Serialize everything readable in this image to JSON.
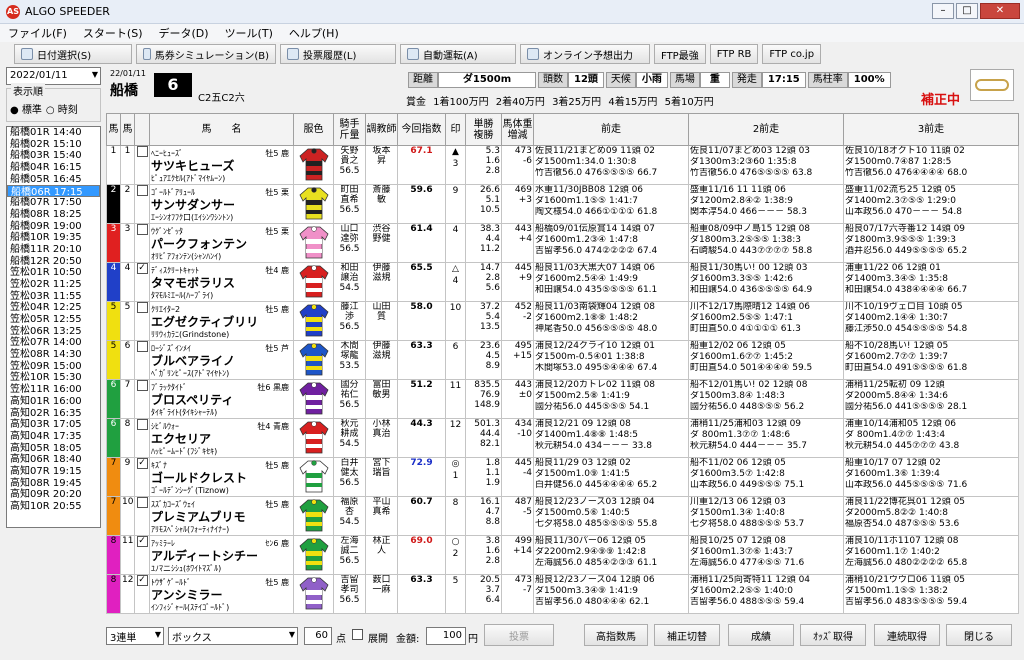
{
  "app": {
    "title": "ALGO SPEEDER",
    "icon_text": "AS"
  },
  "menu": [
    "ファイル(F)",
    "スタート(S)",
    "データ(D)",
    "ツール(T)",
    "ヘルプ(H)"
  ],
  "toolbar": [
    "日付選択(S)",
    "馬券シミュレーション(B)",
    "投票履歴(L)",
    "自動運転(A)",
    "オンライン予想出力",
    "FTP最強",
    "FTP RB",
    "FTP co.jp"
  ],
  "left": {
    "date": "2022/01/11",
    "order_label": "表示順",
    "radio1": "● 標準",
    "radio2": "○ 時刻",
    "races": [
      "船橋01R 14:40",
      "船橋02R 15:10",
      "船橋03R 15:40",
      "船橋04R 16:15",
      "船橋05R 16:45",
      "船橋06R 17:15",
      "船橋07R 17:50",
      "船橋08R 18:25",
      "船橋09R 19:00",
      "船橋10R 19:35",
      "船橋11R 20:10",
      "船橋12R 20:50",
      "笠松01R 10:50",
      "笠松02R 11:25",
      "笠松03R 11:55",
      "笠松04R 12:25",
      "笠松05R 12:55",
      "笠松06R 13:25",
      "笠松07R 14:00",
      "笠松08R 14:30",
      "笠松09R 15:00",
      "笠松10R 15:30",
      "笠松11R 16:00",
      "高知01R 16:00",
      "高知02R 16:35",
      "高知03R 17:05",
      "高知04R 17:35",
      "高知05R 18:05",
      "高知06R 18:40",
      "高知07R 19:15",
      "高知08R 19:45",
      "高知09R 20:20",
      "高知10R 20:55"
    ]
  },
  "race": {
    "date": "22/01/11",
    "venue": "船橋",
    "number": "6",
    "class": "C2五C2六",
    "dist_label": "距離",
    "dist": "ダ1500m",
    "heads_label": "頭数",
    "heads": "12頭",
    "weather_label": "天候",
    "weather": "小雨",
    "track_label": "馬場",
    "track": "重",
    "start_label": "発走",
    "start": "17:15",
    "post_label": "馬柱率",
    "post": "100%",
    "prize": "賞金 1着100万円 2着40万円 3着25万円 4着15万円 5着10万円",
    "correction": "補正中"
  },
  "columns": [
    "馬",
    "馬",
    "馬　　名",
    "服色",
    "騎手\n斤量",
    "調教師",
    "今回指数",
    "印",
    "単勝\n複勝",
    "馬体重\n増減",
    "前走",
    "2前走",
    "3前走"
  ],
  "horses": [
    {
      "waku": "1",
      "wcolor": "#ffffff",
      "no": "1",
      "chk": "",
      "sire": "ﾍﾆｰﾋｭｰｽﾞ",
      "sex": "牡5 鹿",
      "name": "サツキヒューズ",
      "dam": "ﾋﾟｭｱｴｸｾﾙ(ｱﾄﾞﾏｲﾔﾑｰﾝ)",
      "jockey": "矢野\n貴之\n56.5",
      "trainer": "坂本\n昇",
      "idx": "67.1",
      "idxc": "#d01818",
      "mark": "▲\n3",
      "odds": "5.3\n1.6\n2.8",
      "wt": "473\n-6",
      "c1": "#cc2222",
      "c2": "#222222",
      "p": [
        [
          "佐良11/21まどめ09 11頭 02",
          "ダ1500m1:34.0 1:30:8",
          "竹吉徹56.0 476⑤⑤⑤⑤ 66.7"
        ],
        [
          "佐良11/07まどめ03 12頭 03",
          "ダ1300m3:2③60 1:35:8",
          "竹吉徹56.0 476⑤⑤⑤⑤ 63.8"
        ],
        [
          "佐良10/18オクト10 11頭 02",
          "ダ1500m0.7④87 1:28:5",
          "竹吉徹56.0 476④④④④ 68.0"
        ]
      ]
    },
    {
      "waku": "2",
      "wcolor": "#000000",
      "no": "2",
      "chk": "",
      "sire": "ｺﾞｰﾙﾄﾞｱﾘｭｰﾙ",
      "sex": "牡5 栗",
      "name": "サンサダンサー",
      "dam": "ｴｰｼﾝｵﾌﾌｸ口(ｴｲｼﾝﾜｼﾝﾄﾝ)",
      "jockey": "町田\n直希\n56.5",
      "trainer": "斎藤\n敏",
      "idx": "59.6",
      "idxc": "#000",
      "mark": "9",
      "odds": "26.6\n5.1\n10.5",
      "wt": "469\n+3",
      "c1": "#e8e020",
      "c2": "#222222",
      "p": [
        [
          "水重11/30JBB08 12頭 06",
          "ダ1600m1.1⑤⑤ 1:41:7",
          "陶文様54.0 466①①①① 61.8"
        ],
        [
          "盛重11/16 11 11頭 06",
          "ダ1200m2.8④② 1:38:9",
          "関本淳54.0 466－－－ 58.3"
        ],
        [
          "盛重11/02流ち25 12頭 05",
          "ダ1400m2.3⑦⑤⑤ 1:29:0",
          "山本政56.0 470－－－ 54.8"
        ]
      ]
    },
    {
      "waku": "3",
      "wcolor": "#e02020",
      "no": "3",
      "chk": "",
      "sire": "ｳｸﾞﾝｾﾞｯﾀ",
      "sex": "牡5 栗",
      "name": "パークフォンテン",
      "dam": "ｵﾘﾋﾞｱﾌｫﾝﾃﾝ(ｼｬﾝﾊﾝｲ)",
      "jockey": "山口\n達弥\n56.5",
      "trainer": "渋谷\n野健",
      "idx": "61.4",
      "idxc": "#000",
      "mark": "4",
      "odds": "38.3\n4.4\n11.2",
      "wt": "443\n+4",
      "c1": "#f090c8",
      "c2": "#ffffff",
      "p": [
        [
          "船橋09/01伝原賞14 14頭 07",
          "ダ1600m1.2③④ 1:47:8",
          "吉留孝56.0 474②②②② 67.4"
        ],
        [
          "船重08/09中ノ島15 12頭 08",
          "ダ1800m3.2⑤⑤⑤ 1:38:3",
          "石崎駿54.0 443⑦⑦⑦⑦ 58.8"
        ],
        [
          "船良07/17六寺番12 14頭 09",
          "ダ1800m3.9⑤⑤⑤ 1:39:3",
          "酒井忍56.0 449⑤⑤⑤⑤ 65.2"
        ]
      ]
    },
    {
      "waku": "4",
      "wcolor": "#2040c8",
      "no": "4",
      "chk": "✓",
      "sire": "ﾃﾞｨｽｸﾘｰﾄｷｬｯﾄ",
      "sex": "牡4 鹿",
      "name": "タマモボラリス",
      "dam": "ﾀﾏﾓﾙﾐｴｰﾙ(ﾊｰﾌﾞﾗｲ)",
      "jockey": "和田\n譲治\n54.5",
      "trainer": "伊藤\n滋規",
      "idx": "65.5",
      "idxc": "#000",
      "mark": "△\n4",
      "odds": "14.7\n2.8\n5.6",
      "wt": "445\n+9",
      "c1": "#d82020",
      "c2": "#ffffff",
      "p": [
        [
          "船良11/03大黒大07 14頭 06",
          "ダ1600m2.5④④ 1:49:9",
          "和田譲54.0 435⑤⑤⑤⑤ 61.1"
        ],
        [
          "船良11/30馬い! 00 12頭 03",
          "ダ1600m3.3⑤⑤ 1:42:6",
          "和田譲54.0 436⑤⑤⑤⑤ 64.9"
        ],
        [
          "浦重11/22 06 12頭 01",
          "ダ1400m3.3④⑤ 1:35:8",
          "和田譲54.0 438④④④④ 66.7"
        ]
      ]
    },
    {
      "waku": "5",
      "wcolor": "#f0e010",
      "no": "5",
      "chk": "",
      "sire": "ｸﾘｴｲﾀｰ2",
      "sex": "牡5 鹿",
      "name": "エグゼクティブリリ",
      "dam": "ﾘﾘｳｨｶﾗﾆ(Grindstone)",
      "jockey": "藤江\n渉\n56.5",
      "trainer": "山田\n質",
      "idx": "58.0",
      "idxc": "#000",
      "mark": "10",
      "odds": "37.2\n5.4\n13.5",
      "wt": "452\n-2",
      "c1": "#2040c8",
      "c2": "#f0e010",
      "p": [
        [
          "船良11/03南袋輝04 12頭 08",
          "ダ1600m2.1⑧⑧ 1:48:2",
          "神尾香50.0 456⑤⑤⑤⑤ 48.0"
        ],
        [
          "川不12/17馬際晴12 14頭 06",
          "ダ1600m2.5⑤⑤ 1:47:1",
          "町田直50.0 4①①①① 61.3"
        ],
        [
          "川不10/19ヴェロ目 10頭 05",
          "ダ1400m2.1④④ 1:30:7",
          "藤江渉50.0 454⑤⑤⑤⑤ 54.8"
        ]
      ]
    },
    {
      "waku": "5",
      "wcolor": "#f0e010",
      "no": "6",
      "chk": "",
      "sire": "ﾛｰｼﾞｽﾞｲﾝﾒｲ",
      "sex": "牡5 芦",
      "name": "ブルベアライノ",
      "dam": "ﾍﾞｶﾞﾘﾝﾋﾟｰｽ(ｱﾄﾞﾏｲﾔﾄﾝ)",
      "jockey": "木間\n塚龍\n53.5",
      "trainer": "伊藤\n滋規",
      "idx": "63.3",
      "idxc": "#000",
      "mark": "6",
      "odds": "23.6\n4.5\n8.9",
      "wt": "495\n+15",
      "c1": "#1e56c8",
      "c2": "#f0e010",
      "p": [
        [
          "浦良12/24クライ10 12頭 01",
          "ダ1500m-0.5④01 1:38:8",
          "木間塚53.0 495⑤④④④ 67.4"
        ],
        [
          "船重12/02 06 12頭 05",
          "ダ1600m1.6⑦⑦ 1:45:2",
          "町田直54.0 501④④④④ 59.5"
        ],
        [
          "船不10/28馬い! 12頭 05",
          "ダ1600m2.7⑦⑦ 1:39:7",
          "町田直54.0 491⑤⑤⑤⑤ 61.8"
        ]
      ]
    },
    {
      "waku": "6",
      "wcolor": "#20a040",
      "no": "7",
      "chk": "",
      "sire": "ﾌﾞﾗｯｸﾀｲﾄﾞ",
      "sex": "牡6 黒鹿",
      "name": "ブロスペリティ",
      "dam": "ﾀｲｷﾞﾗｲﾄ(ﾀｲｷｼｬｰﾃﾙ)",
      "jockey": "國分\n祐仁\n56.5",
      "trainer": "富田\n敏男",
      "idx": "51.2",
      "idxc": "#000",
      "mark": "11",
      "odds": "835.5\n76.9\n148.9",
      "wt": "443\n±0",
      "c1": "#7020a0",
      "c2": "#ffffff",
      "p": [
        [
          "浦良12/20カトレ02 11頭 08",
          "ダ1500m2.5⑧ 1:41:9",
          "國分祐56.0 445⑤⑤⑤ 54.1"
        ],
        [
          "船不12/01馬い! 02 12頭 08",
          "ダ1500m3.8④ 1:48:3",
          "國分祐56.0 448⑤⑤⑤ 56.2"
        ],
        [
          "浦稍11/25転初 09 12頭 ",
          "ダ2000m5.8④④ 1:34:6",
          "國分祐56.0 441⑤⑤⑤⑤ 28.1"
        ]
      ]
    },
    {
      "waku": "6",
      "wcolor": "#20a040",
      "no": "8",
      "chk": "",
      "sire": "ｼﾋﾞﾙｳｫｰ",
      "sex": "牡4 青鹿",
      "name": "エクセリア",
      "dam": "ﾊｯﾋﾟｰﾑｰﾄﾞ(ﾌｼﾞｷｾｷ)",
      "jockey": "秋元\n耕成\n54.5",
      "trainer": "小林\n真治",
      "idx": "44.3",
      "idxc": "#000",
      "mark": "12",
      "odds": "501.3\n44.4\n82.1",
      "wt": "434\n-10",
      "c1": "#d82020",
      "c2": "#ffffff",
      "p": [
        [
          "浦良12/21 09 12頭 08",
          "ダ1400m1.4⑧⑧ 1:48:5",
          "秋元耕54.0 434－－－ 33.8"
        ],
        [
          "浦稍11/25浦和03 12頭 09",
          "ダ 800m1.3⑦⑦ 1:48:6",
          "秋元耕54.0 444－－－ 35.7"
        ],
        [
          "浦重10/14浦和05 12頭 06",
          "ダ 800m1.4⑦⑦ 1:43:4",
          "秋元耕54.0 445⑦⑦⑦ 43.8"
        ]
      ]
    },
    {
      "waku": "7",
      "wcolor": "#f08c10",
      "no": "9",
      "chk": "✓",
      "sire": "ｷｽﾞﾅ",
      "sex": "牡5 鹿",
      "name": "ゴールドクレスト",
      "dam": "ｺﾞｰﾙﾃﾞﾝｼｰｸﾞ(Tiznow)",
      "jockey": "白井\n健太\n56.5",
      "trainer": "宮下\n瑞旨",
      "idx": "72.9",
      "idxc": "#1a2ec8",
      "mark": "◎\n1",
      "odds": "1.8\n1.1\n1.9",
      "wt": "445\n-4",
      "c1": "#ffffff",
      "c2": "#20a040",
      "p": [
        [
          "船良11/29 03 12頭 02",
          "ダ1500m1.0⑨ 1:41:5",
          "白井健56.0 445④④④④ 65.2"
        ],
        [
          "船不11/02 06 12頭 05",
          "ダ1600m3.5⑦ 1:42:8",
          "山本政56.0 449⑤⑤⑤ 75.1"
        ],
        [
          "船重10/17 07 12頭 02",
          "ダ1600m1.3⑥ 1:39:4",
          "山本政56.0 445⑤⑤⑤⑤ 71.6"
        ]
      ]
    },
    {
      "waku": "7",
      "wcolor": "#f08c10",
      "no": "10",
      "chk": "",
      "sire": "ｽｽﾞｶｺｰｽﾞｳｪｲ",
      "sex": "牡5 鹿",
      "name": "プレミアムブリモ",
      "dam": "ｱﾘﾓｽﾍﾟｼｬﾙ(ﾌｫｰﾃｨﾅｲﾅｰ)",
      "jockey": "福原\n杏\n54.5",
      "trainer": "平山\n真希",
      "idx": "60.7",
      "idxc": "#000",
      "mark": "8",
      "odds": "16.1\n4.7\n8.8",
      "wt": "487\n-5",
      "c1": "#20a040",
      "c2": "#f0e010",
      "p": [
        [
          "船良12/23ノース03 12頭 04",
          "ダ1500m0.5⑥ 1:40:5",
          "七夕将58.0 485⑤⑤⑤⑤ 55.8"
        ],
        [
          "川重12/13 06 12頭 03",
          "ダ1500m1.3④ 1:40:8",
          "七夕将58.0 488⑤⑤⑤ 53.7"
        ],
        [
          "浦良11/22博花呉01 12頭 05",
          "ダ2000m5.8②② 1:40:8",
          "福原杏54.0 487⑤⑤⑤ 53.6"
        ]
      ]
    },
    {
      "waku": "8",
      "wcolor": "#e020c0",
      "no": "11",
      "chk": "✓",
      "sire": "ｱｯﾐﾗｰﾚ",
      "sex": "ｾﾝ6 鹿",
      "name": "アルディートシチー",
      "dam": "ﾕﾉﾏニｼｼｭ(ﾎﾜｲﾄﾏｽﾞﾙ)",
      "jockey": "左海\n誠二\n56.5",
      "trainer": "林正\n人",
      "idx": "69.0",
      "idxc": "#d01818",
      "mark": "○\n2",
      "odds": "3.8\n1.6\n2.8",
      "wt": "499\n+14",
      "c1": "#20a040",
      "c2": "#f0e010",
      "p": [
        [
          "船良11/30パー06 12頭 05",
          "ダ2200m2.9④⑨⑨ 1:42:8",
          "左海誠56.0 485④②③③ 61.1"
        ],
        [
          "船良10/25 07 12頭 08",
          "ダ1600m1.3⑦⑥ 1:43:7",
          "左海誠56.0 477④⑤⑤ 71.6"
        ],
        [
          "浦良10/11ホ1107 12頭 08",
          "ダ1600m1.1⑦ 1:40:2",
          "左海誠56.0 480②②②② 65.8"
        ]
      ]
    },
    {
      "waku": "8",
      "wcolor": "#e020c0",
      "no": "12",
      "chk": "✓",
      "sire": "ﾄｳｻﾞｹﾞｰﾙﾄﾞ",
      "sex": "牡5 鹿",
      "name": "アンシミラー",
      "dam": "ｲﾝﾌｨｼﾞｬｰﾙ(ｽﾃｲｺﾞｰﾙﾄﾞ)",
      "jockey": "吉留\n孝司\n56.5",
      "trainer": "薮口\n一麻",
      "idx": "63.3",
      "idxc": "#000",
      "mark": "5",
      "odds": "20.5\n3.7\n6.4",
      "wt": "473\n-7",
      "c1": "#9060c8",
      "c2": "#ffffff",
      "p": [
        [
          "船良12/23ノース04 12頭 06",
          "ダ1500m3.3④⑨ 1:41:9",
          "吉留孝56.0 480④④④ 62.1"
        ],
        [
          "浦稍11/25向寄特11 12頭 04",
          "ダ1600m2.2⑤⑤ 1:40:0",
          "吉留孝56.0 488⑤⑤⑤ 59.4"
        ],
        [
          "浦稍10/21ウウロ06 11頭 05",
          "ダ1500m1.1⑤⑤ 1:38:2",
          "吉留孝56.0 483⑤⑤⑤⑤ 59.4"
        ]
      ]
    }
  ],
  "bottom": {
    "bet_type": "3連単",
    "mode": "ボックス",
    "points": "60",
    "points_unit": "点",
    "expand": "展開",
    "amount_label": "金額:",
    "amount": "100",
    "amount_unit": "円",
    "vote": "投票",
    "buttons": [
      "高指数馬",
      "補正切替",
      "成績",
      "ｵｯｽﾞ取得",
      "連続取得",
      "閉じる"
    ]
  }
}
